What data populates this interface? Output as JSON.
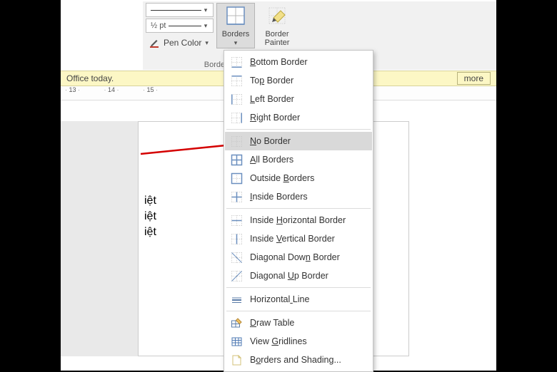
{
  "ribbon": {
    "line_weight_label": "½ pt",
    "pen_color_label": "Pen Color",
    "borders_btn": "Borders",
    "border_painter_btn_l1": "Border",
    "border_painter_btn_l2": "Painter",
    "group_caption": "Borders"
  },
  "message_bar": {
    "left_text": "Office today.",
    "more_label": "more"
  },
  "ruler": {
    "ticks": [
      "13",
      "14",
      "15"
    ]
  },
  "doc": {
    "lines": [
      "iệt",
      "iệt",
      "iệt"
    ]
  },
  "menu": [
    {
      "id": "bottom",
      "label": "Bottom Border",
      "accel_idx": 0,
      "icon": "border-bottom"
    },
    {
      "id": "top",
      "label": "Top Border",
      "accel_idx": 2,
      "icon": "border-top"
    },
    {
      "id": "left",
      "label": "Left Border",
      "accel_idx": 0,
      "icon": "border-left"
    },
    {
      "id": "right",
      "label": "Right Border",
      "accel_idx": 0,
      "icon": "border-right"
    },
    "sep",
    {
      "id": "none",
      "label": "No Border",
      "accel_idx": 0,
      "icon": "border-none",
      "hovered": true
    },
    {
      "id": "all",
      "label": "All Borders",
      "accel_idx": 0,
      "icon": "border-all"
    },
    {
      "id": "outside",
      "label": "Outside Borders",
      "accel_idx": 8,
      "icon": "border-outside"
    },
    {
      "id": "inside",
      "label": "Inside Borders",
      "accel_idx": 0,
      "icon": "border-inside"
    },
    "sep",
    {
      "id": "ih",
      "label": "Inside Horizontal Border",
      "accel_idx": 7,
      "icon": "border-in-h"
    },
    {
      "id": "iv",
      "label": "Inside Vertical Border",
      "accel_idx": 7,
      "icon": "border-in-v"
    },
    {
      "id": "ddown",
      "label": "Diagonal Down Border",
      "accel_idx": 12,
      "icon": "border-diag-down"
    },
    {
      "id": "dup",
      "label": "Diagonal Up Border",
      "accel_idx": 9,
      "icon": "border-diag-up"
    },
    "sep",
    {
      "id": "hline",
      "label": "Horizontal Line",
      "accel_idx": 10,
      "icon": "hline"
    },
    "sep",
    {
      "id": "draw",
      "label": "Draw Table",
      "accel_idx": 0,
      "icon": "draw-table"
    },
    {
      "id": "grid",
      "label": "View Gridlines",
      "accel_idx": 5,
      "icon": "view-gridlines"
    },
    {
      "id": "shade",
      "label": "Borders and Shading...",
      "accel_idx": 1,
      "icon": "doc"
    }
  ]
}
